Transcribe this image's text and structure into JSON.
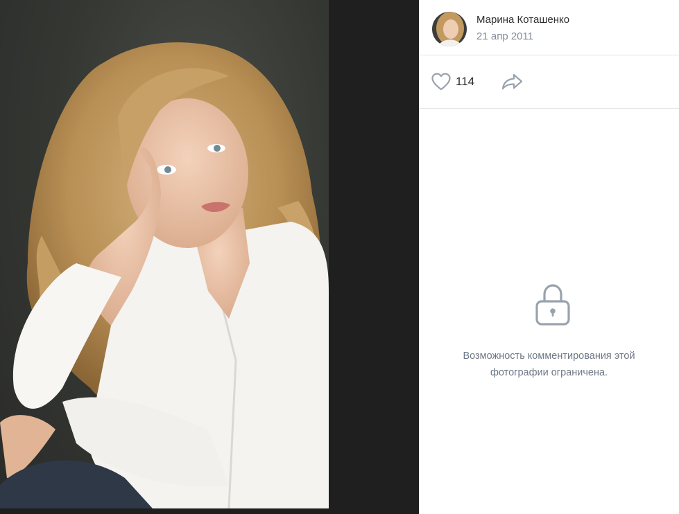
{
  "author": {
    "name": "Марина Коташенко",
    "date": "21 апр 2011",
    "avatar_icon": "user-avatar"
  },
  "actions": {
    "like_icon": "heart-icon",
    "like_count": "114",
    "share_icon": "share-icon"
  },
  "comments": {
    "lock_icon": "lock-icon",
    "restricted_text": "Возможность комментирования этой фотографии ограничена."
  },
  "colors": {
    "viewer_background": "#1f1f1f",
    "panel_background": "#ffffff",
    "divider": "#e4e6ea",
    "secondary_text": "#818c99",
    "icon": "#99a2ad"
  }
}
